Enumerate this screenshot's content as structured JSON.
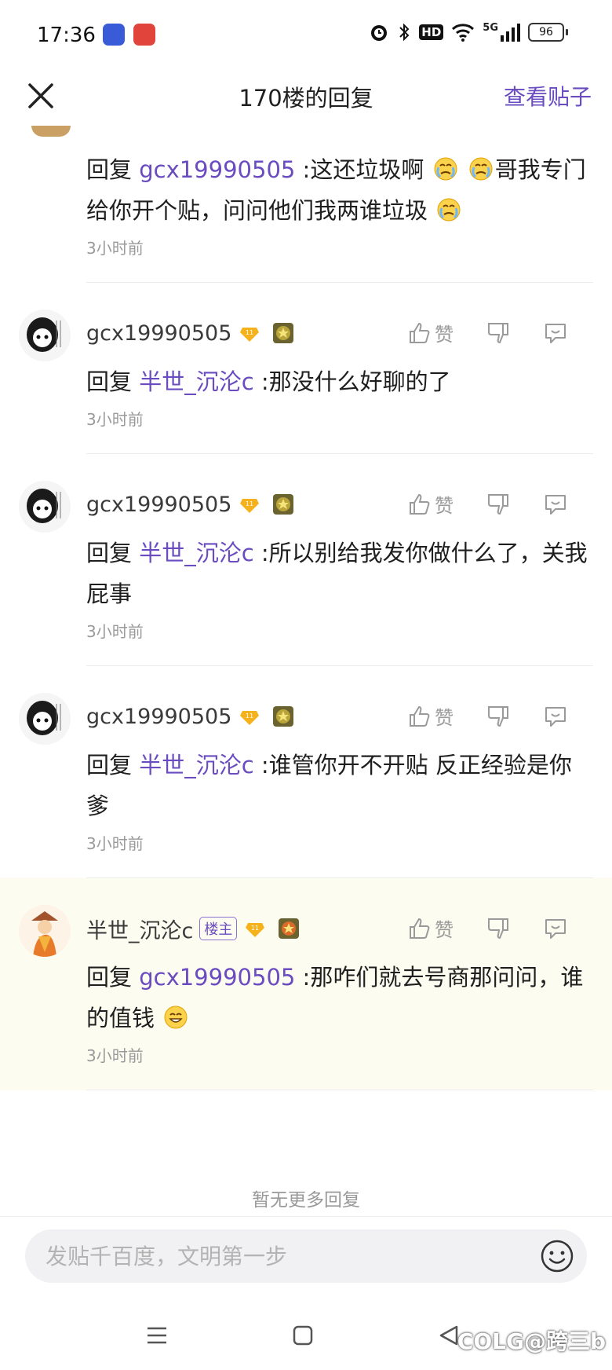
{
  "status": {
    "time": "17:36",
    "hd": "HD",
    "network": "5G",
    "battery": "96"
  },
  "header": {
    "title": "170楼的回复",
    "view_post": "查看贴子"
  },
  "first_reply": {
    "prefix": "回复 ",
    "mention": "gcx19990505",
    "text_a": " :这还垃圾啊",
    "text_b": "哥我专门给你开个贴，问问他们我两谁垃圾",
    "time": "3小时前"
  },
  "replies": [
    {
      "username": "gcx19990505",
      "level": "11",
      "like_label": "赞",
      "prefix": "回复 ",
      "mention": "半世_沉沦c",
      "text": " :那没什么好聊的了",
      "time": "3小时前"
    },
    {
      "username": "gcx19990505",
      "level": "11",
      "like_label": "赞",
      "prefix": "回复 ",
      "mention": "半世_沉沦c",
      "text": " :所以别给我发你做什么了，关我屁事",
      "time": "3小时前"
    },
    {
      "username": "gcx19990505",
      "level": "11",
      "like_label": "赞",
      "prefix": "回复 ",
      "mention": "半世_沉沦c",
      "text": " :谁管你开不开贴 反正经验是你爹",
      "time": "3小时前"
    },
    {
      "username": "半世_沉沦c",
      "owner_badge": "楼主",
      "level": "11",
      "like_label": "赞",
      "prefix": "回复 ",
      "mention": "gcx19990505",
      "text": " :那咋们就去号商那问问，谁的值钱",
      "time": "3小时前"
    }
  ],
  "no_more": "暂无更多回复",
  "input": {
    "placeholder": "发贴千百度，文明第一步"
  },
  "watermark": "COLG@跨三b",
  "colors": {
    "accent": "#6a4cc0",
    "highlight_bg": "#fdfcf0",
    "muted": "#9a9a9a"
  }
}
